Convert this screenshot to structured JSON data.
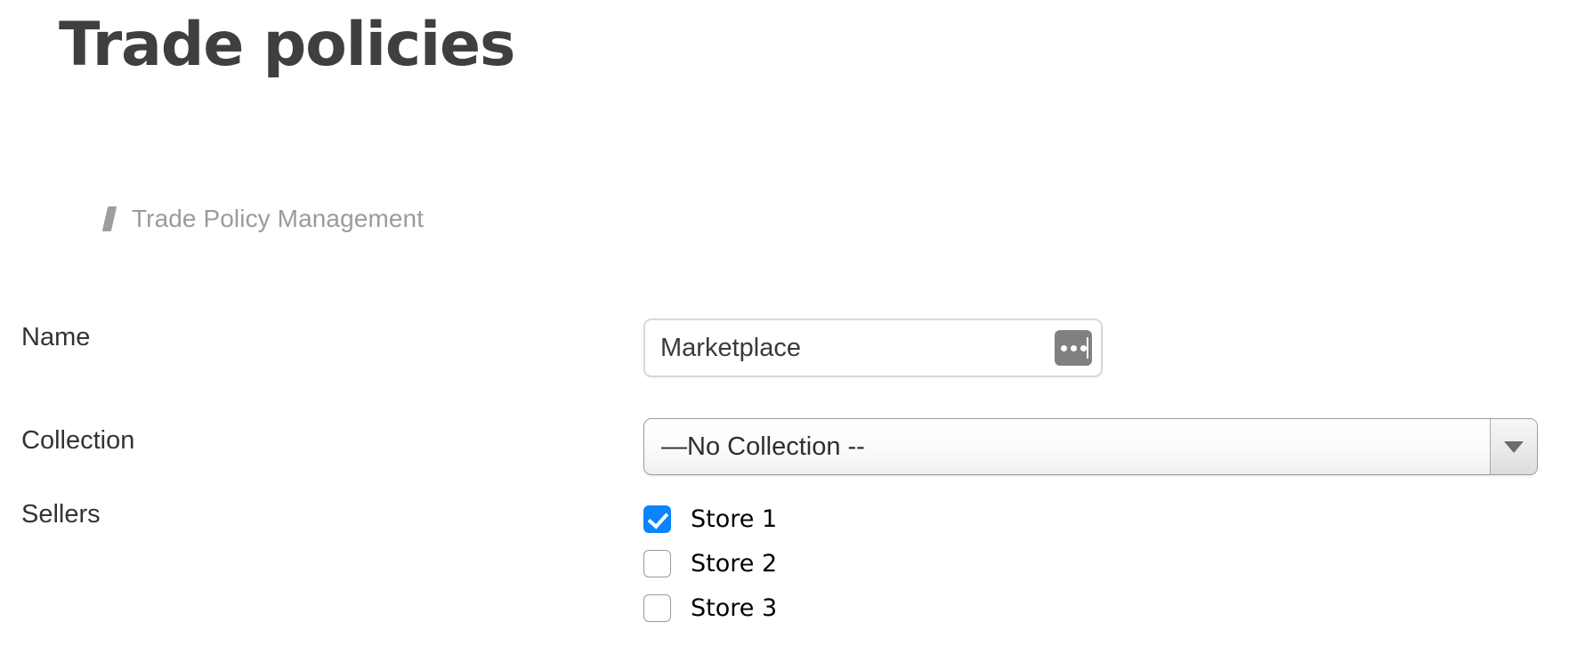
{
  "page": {
    "title": "Trade policies"
  },
  "breadcrumb": {
    "icon": "slash-bar-icon",
    "label": "Trade Policy Management"
  },
  "form": {
    "name": {
      "label": "Name",
      "value": "Marketplace",
      "placeholder": "",
      "more_button": {
        "icon": "ellipsis-icon",
        "label": "..."
      }
    },
    "collection": {
      "label": "Collection",
      "selected": "—No Collection --",
      "options": [
        "—No Collection --"
      ],
      "arrow_icon": "triangle-down-icon"
    },
    "sellers": {
      "label": "Sellers",
      "items": [
        {
          "label": "Store 1",
          "checked": true
        },
        {
          "label": "Store 2",
          "checked": false
        },
        {
          "label": "Store 3",
          "checked": false
        }
      ]
    }
  },
  "colors": {
    "title": "#3f3f3f",
    "breadcrumb": "#9b9b9b",
    "label": "#333333",
    "checkbox_checked": "#0a84ff",
    "ellipsis_button": "#808080",
    "background": "#ffffff"
  }
}
